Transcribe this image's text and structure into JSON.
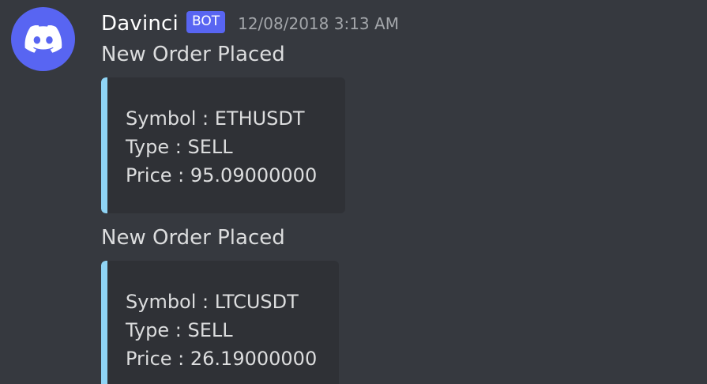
{
  "message_group": {
    "author": {
      "name": "Davinci",
      "tag": "BOT",
      "avatar_icon": "discord-logo-icon",
      "avatar_color": "#5865f2"
    },
    "timestamp": "12/08/2018 3:13 AM",
    "messages": [
      {
        "text": "New Order Placed",
        "embed": {
          "accent_color": "#8fd4f5",
          "lines": [
            "Symbol : ETHUSDT",
            "Type : SELL",
            "Price : 95.09000000"
          ]
        }
      },
      {
        "text": "New Order Placed",
        "embed": {
          "accent_color": "#8fd4f5",
          "lines": [
            "Symbol : LTCUSDT",
            "Type : SELL",
            "Price : 26.19000000"
          ]
        }
      }
    ]
  }
}
